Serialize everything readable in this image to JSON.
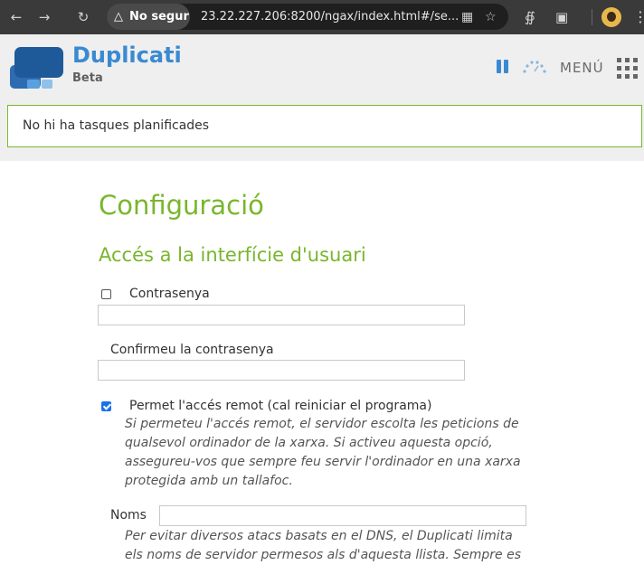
{
  "browser": {
    "security_label": "No segur",
    "url": "23.22.227.206:8200/ngax/index.html#/se..."
  },
  "app": {
    "name": "Duplicati",
    "tag": "Beta",
    "menu_label": "MENÚ",
    "brand_blue": "#3a8ad2",
    "accent_green": "#79b62c"
  },
  "status": {
    "text": "No hi ha tasques planificades"
  },
  "main": {
    "title": "Configuració",
    "section_title": "Accés a la interfície d'usuari",
    "password": {
      "label": "Contrasenya",
      "checked": false,
      "value": ""
    },
    "confirm_password": {
      "label": "Confirmeu la contrasenya",
      "value": ""
    },
    "remote_access": {
      "label": "Permet l'accés remot (cal reiniciar el programa)",
      "checked": true,
      "hint_lines": [
        "Si permeteu l'accés remot, el servidor escolta les peticions de",
        "qualsevol ordinador de la xarxa. Si activeu aquesta opció,",
        "assegureu-vos que sempre feu servir l'ordinador en una xarxa",
        "protegida amb un tallafoc."
      ]
    },
    "hostnames": {
      "label": "Noms",
      "value": "",
      "hint_lines": [
        "Per evitar diversos atacs basats en el DNS, el Duplicati limita",
        "els noms de servidor permesos als d'aquesta llista. Sempre es"
      ]
    }
  },
  "icons": [
    "back-arrow-icon",
    "forward-arrow-icon",
    "reload-icon",
    "warning-icon",
    "translate-icon",
    "star-icon",
    "extension-icon",
    "puzzle-icon",
    "profile-avatar",
    "kebab-menu-icon",
    "pause-icon",
    "throttle-icon",
    "apps-grid-icon"
  ]
}
